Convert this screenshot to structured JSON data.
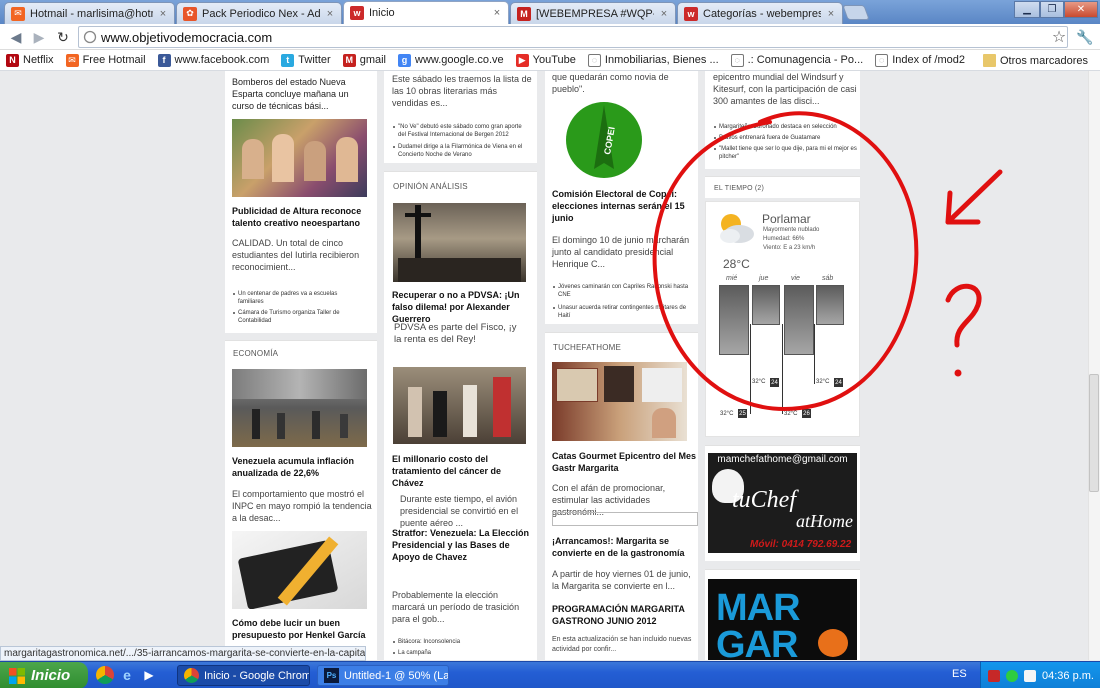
{
  "tabs": [
    {
      "title": "Hotmail - marlisima@hotmail.co",
      "icon": "hotmail-icon",
      "color": "#f26522"
    },
    {
      "title": "Pack Periodico Nex - Administ",
      "icon": "joomla-icon",
      "color": "#e8562a"
    },
    {
      "title": "Inicio",
      "icon": "site-icon",
      "color": "#cc2a2a"
    },
    {
      "title": "[WEBEMPRESA #WQP-91736",
      "icon": "gmail-icon",
      "color": "#c5221f"
    },
    {
      "title": "Categorías - webempresa joor",
      "icon": "site-icon",
      "color": "#cc2a2a"
    }
  ],
  "address": {
    "url": "www.objetivodemocracia.com"
  },
  "bookmarks": [
    {
      "label": "Netflix",
      "icon": "netflix-icon",
      "color": "#b20710"
    },
    {
      "label": "Free Hotmail",
      "icon": "hotmail-icon",
      "color": "#f26522"
    },
    {
      "label": "www.facebook.com",
      "icon": "facebook-icon",
      "color": "#3b5998"
    },
    {
      "label": "Twitter",
      "icon": "twitter-icon",
      "color": "#2aa9e0"
    },
    {
      "label": "gmail",
      "icon": "gmail-icon",
      "color": "#c5221f"
    },
    {
      "label": "www.google.co.ve",
      "icon": "google-icon",
      "color": "#4285f4"
    },
    {
      "label": "YouTube",
      "icon": "youtube-icon",
      "color": "#e52d27"
    },
    {
      "label": "Inmobiliarias, Bienes ...",
      "icon": "globe-icon",
      "color": "#777777"
    },
    {
      "label": ".: Comunagencia - Po...",
      "icon": "globe-icon",
      "color": "#777777"
    },
    {
      "label": "Index of /mod2",
      "icon": "globe-icon",
      "color": "#777777"
    }
  ],
  "bookmarks_more": "»",
  "bookmarks_other": "Otros marcadores",
  "col1": {
    "top_text": "Bomberos del estado Nueva Esparta concluye mañana un curso de técnicas bási...",
    "h1": "Publicidad de Altura reconoce talento creativo neoespartano",
    "p1": "CALIDAD. Un total de cinco estudiantes del Iutirla recibieron reconocimient...",
    "links1": [
      "Un centenar de padres va a escuelas familiares",
      "Cámara de Turismo organiza Taller de Contabilidad"
    ],
    "section": "ECONOMÍA",
    "h2": "Venezuela acumula inflación anualizada de 22,6%",
    "p2": "El comportamiento que mostró el INPC en mayo rompió la tendencia a la desac...",
    "h3": "Cómo debe lucir un buen presupuesto por Henkel García"
  },
  "col2": {
    "top_text": "Este sábado les traemos la lista de las 10 obras literarias más vendidas es...",
    "links1": [
      "\"No Ve\" debutó este sábado como gran aporte del Festival Internacional de Bergen 2012",
      "Dudamel dirige a la Filarmónica de Viena en el Concierto Noche de Verano"
    ],
    "section": "OPINIÓN ANÁLISIS",
    "h1": "Recuperar o no a PDVSA: ¡Un falso dilema! por Alexander Guerrero",
    "p1": "PDVSA es parte del Fisco, ¡y la renta es del Rey!",
    "h2": "El millonario costo del tratamiento del cáncer de Chávez",
    "p2": "Durante este tiempo, el avión presidencial se convirtió en el puente aéreo ...",
    "h3": "Stratfor: Venezuela: La Elección Presidencial y las Bases de Apoyo de Chavez",
    "p3": "Probablemente la elección marcará un período de trasición para el gob...",
    "links2": [
      "Bitácora: Inconsolencia",
      "La campaña"
    ]
  },
  "col3": {
    "top_text": "que quedarán como novia de pueblo\".",
    "h1": "Comisión Electoral de Copei: elecciones internas serán el 15 junio",
    "p1": "El domingo 10 de junio marcharán junto al candidato presidencial Henrique C...",
    "links1": [
      "Jóvenes caminarán con Capriles Radonski hasta CNE",
      "Unasur acuerda retirar contingentes militares de Haití"
    ],
    "section": "TUCHEFATHOME",
    "h2": "Catas Gourmet Epicentro del Mes Gastr Margarita",
    "p2": "Con el afán de promocionar, estimular las actividades gastronómi...",
    "h3": "¡Arrancamos!: Margarita se convierte en de la gastronomía",
    "p3": "A partir de hoy viernes 01 de junio, la Margarita se convierte en l...",
    "h4": "PROGRAMACIÓN MARGARITA GASTRONO JUNIO 2012",
    "p4": "En esta actualización se han incluido nuevas actividad por confir...",
    "copei_logo": "COPEI"
  },
  "col4": {
    "top_text": "epicentro mundial del Windsurf y Kitesurf, con la participación de casi 300 amantes de las disci...",
    "links1": [
      "Margariteño Coronado destaca en selección",
      "Bravos entrenará fuera de Guatamare",
      "\"Mallet tiene que ser lo que dije, para mi el mejor es pitcher\""
    ],
    "section": "EL TIEMPO (2)"
  },
  "weather": {
    "city": "Porlamar",
    "condition": "Mayormente nublado",
    "humidity": "Humedad: 66%",
    "wind": "Viento: E a 23 km/h",
    "temp": "28°C",
    "days": [
      {
        "name": "mié",
        "high": "32°C",
        "low": "25"
      },
      {
        "name": "jue",
        "high": "32°C",
        "low": "24"
      },
      {
        "name": "vie",
        "high": "32°C",
        "low": "26"
      },
      {
        "name": "sáb",
        "high": "32°C",
        "low": "24"
      }
    ]
  },
  "ads": {
    "chef_email": "mamchefathome@gmail.com",
    "chef_brand_1": "tuChef",
    "chef_brand_2": "atHome",
    "chef_phone": "Móvil: 0414 792.69.22",
    "mar_line1": "MAR",
    "mar_line2": "GAR"
  },
  "status_url": "margaritagastronomica.net/.../35-iarrancamos-margarita-se-convierte-en-la-capital-d...",
  "taskbar": {
    "start": "Inicio",
    "items": [
      {
        "label": "Inicio - Google Chrome",
        "icon": "chrome-icon"
      },
      {
        "label": "Untitled-1 @ 50% (La...",
        "icon": "photoshop-icon"
      }
    ],
    "lang": "ES",
    "clock": "04:36 p.m."
  },
  "colors": {
    "annotation": "#e01010",
    "xp_blue": "#245ed4",
    "xp_green": "#3a9a3a"
  }
}
